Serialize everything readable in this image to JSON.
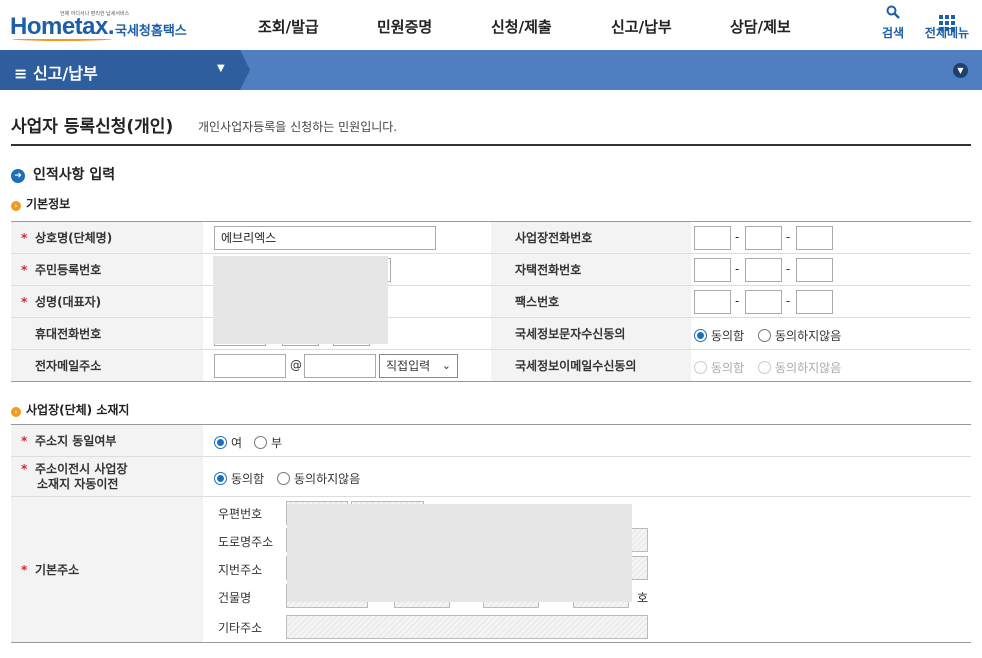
{
  "header": {
    "logo_tagline": "언제 어디서나 편리한 납세서비스",
    "logo_main": "Hometax.",
    "logo_kr": "국세청홈택스",
    "nav": [
      "조회/발급",
      "민원증명",
      "신청/제출",
      "신고/납부",
      "상담/제보"
    ],
    "search_label": "검색",
    "allmenu_label": "전체메뉴"
  },
  "menubar": {
    "title": "≡  신고/납부"
  },
  "page": {
    "title": "사업자 등록신청(개인)",
    "description": "개인사업자등록을 신청하는 민원입니다."
  },
  "section1": {
    "title": "인적사항 입력",
    "sub_title": "기본정보",
    "rows": [
      {
        "label": "상호명(단체명)",
        "required": true,
        "value": "에브리엑스",
        "right_label": "사업장전화번호"
      },
      {
        "label": "주민등록번호",
        "required": true,
        "right_label": "자택전화번호"
      },
      {
        "label": "성명(대표자)",
        "required": true,
        "right_label": "팩스번호"
      },
      {
        "label": "휴대전화번호",
        "required": false,
        "right_label": "국세정보문자수신동의"
      },
      {
        "label": "전자메일주소",
        "required": false,
        "right_label": "국세정보이메일수신동의"
      }
    ],
    "email_at": "@",
    "email_domain_select": "직접입력",
    "dash": "-",
    "agree": "동의함",
    "disagree": "동의하지않음"
  },
  "section2": {
    "sub_title": "사업장(단체) 소재지",
    "same_addr_label": "주소지 동일여부",
    "same_yes": "여",
    "same_no": "부",
    "auto_move_label_1": "주소이전시 사업장",
    "auto_move_label_2": "소재지 자동이전",
    "agree": "동의함",
    "disagree": "동의하지않음",
    "base_addr_label": "기본주소",
    "addr_fields": [
      "우편번호",
      "도로명주소",
      "지번주소",
      "건물명",
      "기타주소"
    ],
    "building_suffix": "호"
  },
  "colors": {
    "brand": "#1d5fa8",
    "menubar": "#4f7fc0",
    "accent_orange": "#f19a1f",
    "required": "#d9262c"
  }
}
